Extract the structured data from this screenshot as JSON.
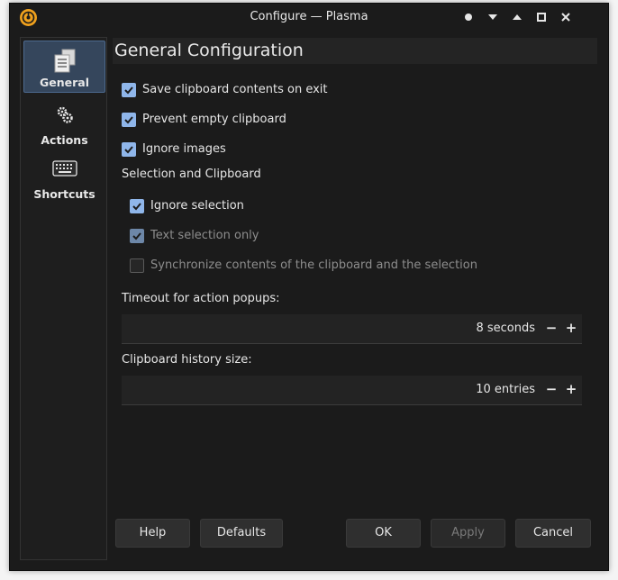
{
  "window": {
    "title": "Configure — Plasma",
    "controls": [
      "keep-on-top",
      "minimize-shade",
      "shade",
      "maximize",
      "close"
    ]
  },
  "sidebar": {
    "items": [
      {
        "label": "General",
        "icon": "documents-icon",
        "active": true
      },
      {
        "label": "Actions",
        "icon": "gears-icon",
        "active": false
      },
      {
        "label": "Shortcuts",
        "icon": "keyboard-icon",
        "active": false
      }
    ]
  },
  "page": {
    "title": "General Configuration",
    "options": {
      "save_contents": {
        "label": "Save clipboard contents on exit",
        "checked": true
      },
      "prevent_empty": {
        "label": "Prevent empty clipboard",
        "checked": true
      },
      "ignore_images": {
        "label": "Ignore images",
        "checked": true
      }
    },
    "selection_section": "Selection and Clipboard",
    "selection_options": {
      "ignore_selection": {
        "label": "Ignore selection",
        "checked": true
      },
      "text_selection_only": {
        "label": "Text selection only",
        "checked": true,
        "enabled": false
      },
      "synchronize": {
        "label": "Synchronize contents of the clipboard and the selection",
        "checked": false,
        "enabled": false
      }
    },
    "timeout": {
      "label": "Timeout for action popups:",
      "value": "8 seconds"
    },
    "history": {
      "label": "Clipboard history size:",
      "value": "10 entries"
    }
  },
  "buttons": {
    "help": "Help",
    "defaults": "Defaults",
    "ok": "OK",
    "apply": "Apply",
    "cancel": "Cancel"
  },
  "colors": {
    "accent": "#8fb6ea",
    "app_icon": "#f0a11d",
    "background": "#1b1b1b"
  }
}
